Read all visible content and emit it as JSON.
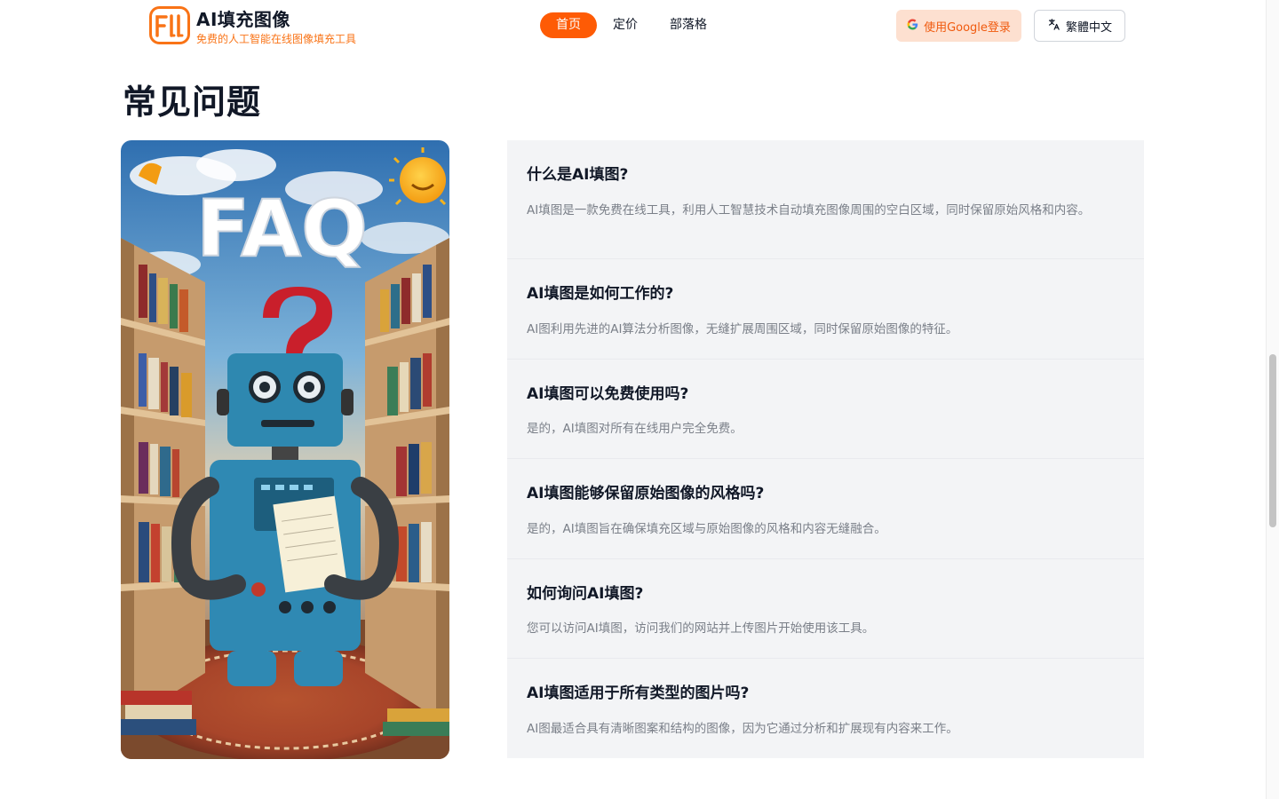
{
  "brand": {
    "title": "AI填充图像",
    "subtitle": "免费的人工智能在线图像填充工具",
    "logo_icon": "fill-logo-icon",
    "accent": "#fe5b05"
  },
  "nav": {
    "items": [
      {
        "label": "首页",
        "active": true
      },
      {
        "label": "定价",
        "active": false
      },
      {
        "label": "部落格",
        "active": false
      }
    ]
  },
  "header_actions": {
    "login_label": "使用Google登录",
    "login_icon": "google-icon",
    "language_label": "繁體中文",
    "language_icon": "translate-icon"
  },
  "faq": {
    "title": "常见问题",
    "image_icon": "faq-robot-illustration",
    "image_text": "FAQ",
    "items": [
      {
        "question": "什么是AI填图?",
        "answer": "AI填图是一款免费在线工具，利用人工智慧技术自动填充图像周围的空白区域，同时保留原始风格和内容。"
      },
      {
        "question": "AI填图是如何工作的?",
        "answer": "AI图利用先进的AI算法分析图像，无缝扩展周围区域，同时保留原始图像的特征。"
      },
      {
        "question": "AI填图可以免费使用吗?",
        "answer": "是的，AI填图对所有在线用户完全免费。"
      },
      {
        "question": "AI填图能够保留原始图像的风格吗?",
        "answer": "是的，AI填图旨在确保填充区域与原始图像的风格和内容无缝融合。"
      },
      {
        "question": "如何询问AI填图?",
        "answer": "您可以访问AI填图，访问我们的网站并上传图片开始使用该工具。"
      },
      {
        "question": "AI填图适用于所有类型的图片吗?",
        "answer": "AI图最适合具有清晰图案和结构的图像，因为它通过分析和扩展现有内容来工作。"
      }
    ]
  }
}
